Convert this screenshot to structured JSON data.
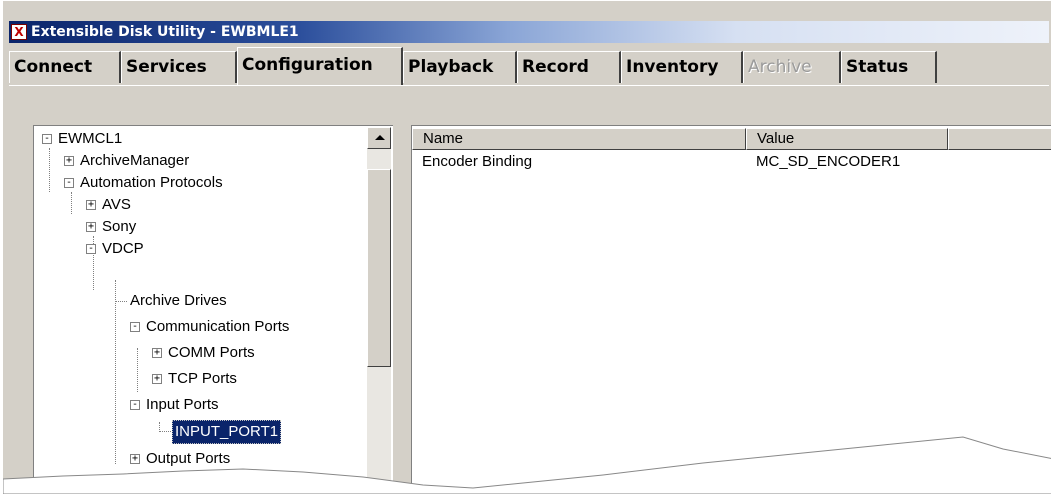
{
  "window": {
    "title": "Extensible Disk Utility - EWBMLE1",
    "icon": "app-icon"
  },
  "tabs": [
    {
      "label": "Connect",
      "state": "normal"
    },
    {
      "label": "Services",
      "state": "normal"
    },
    {
      "label": "Configuration",
      "state": "active"
    },
    {
      "label": "Playback",
      "state": "normal"
    },
    {
      "label": "Record",
      "state": "normal"
    },
    {
      "label": "Inventory",
      "state": "normal"
    },
    {
      "label": "Archive",
      "state": "disabled"
    },
    {
      "label": "Status",
      "state": "normal"
    }
  ],
  "tree": {
    "nodes": [
      {
        "label": "EWMCL1",
        "expander": "-"
      },
      {
        "label": "ArchiveManager",
        "expander": "+"
      },
      {
        "label": "Automation Protocols",
        "expander": "-"
      },
      {
        "label": "AVS",
        "expander": "+"
      },
      {
        "label": "Sony",
        "expander": "+"
      },
      {
        "label": "VDCP",
        "expander": "-"
      },
      {
        "label": "Archive Drives",
        "expander": ""
      },
      {
        "label": "Communication Ports",
        "expander": "-"
      },
      {
        "label": "COMM Ports",
        "expander": "+"
      },
      {
        "label": "TCP Ports",
        "expander": "+"
      },
      {
        "label": "Input Ports",
        "expander": "-"
      },
      {
        "label": "INPUT_PORT1",
        "expander": "",
        "selected": true
      },
      {
        "label": "Output Ports",
        "expander": "+"
      }
    ]
  },
  "list": {
    "columns": [
      "Name",
      "Value",
      ""
    ],
    "rows": [
      {
        "name": "Encoder Binding",
        "value": "MC_SD_ENCODER1"
      }
    ]
  },
  "colors": {
    "face": "#d4d0c8",
    "title_start": "#0a246a",
    "selection": "#0a246a"
  }
}
